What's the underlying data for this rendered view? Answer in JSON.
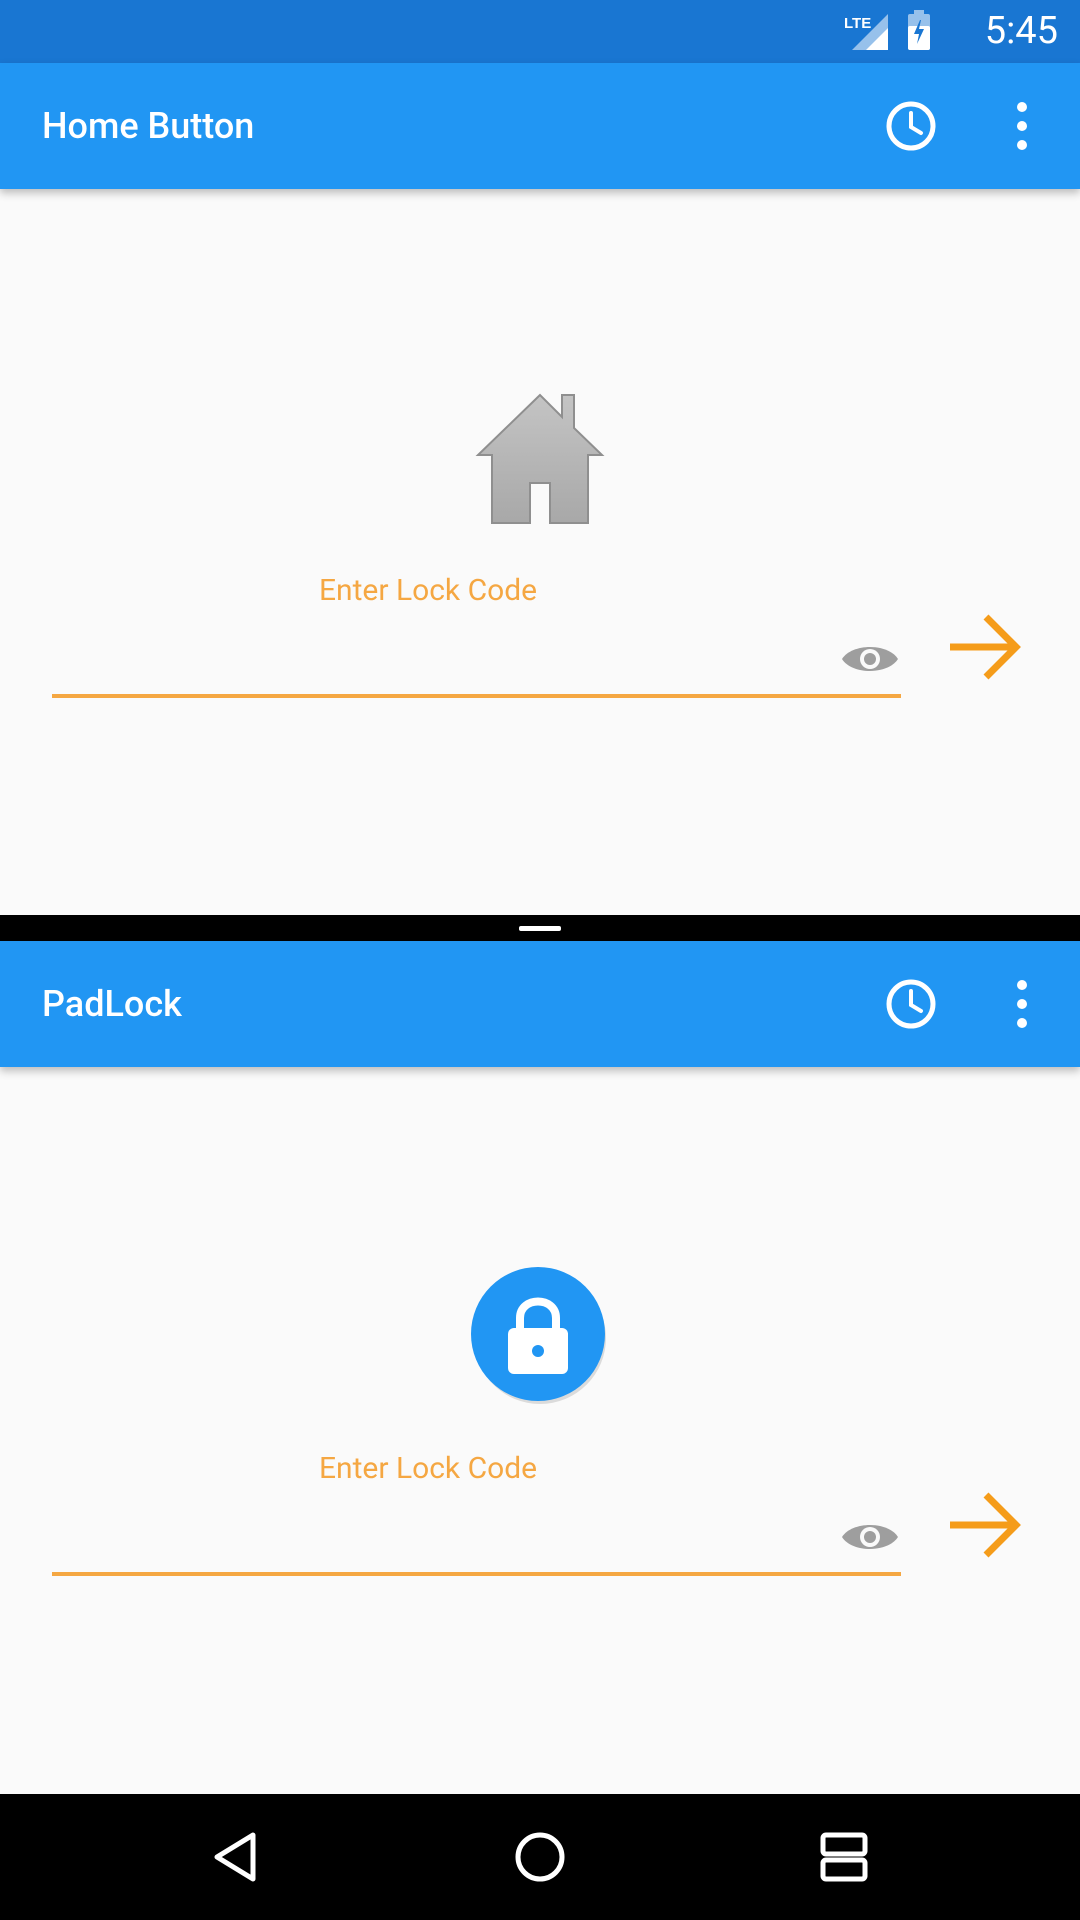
{
  "status_bar": {
    "time": "5:45",
    "network": "LTE",
    "icons": [
      "lte-signal-icon",
      "battery-charging-icon"
    ]
  },
  "top_app": {
    "title": "Home Button",
    "history_icon": "clock-icon",
    "menu_icon": "more-vert-icon",
    "hero_icon": "house-icon",
    "field_label": "Enter Lock Code",
    "input_value": "",
    "visibility_icon": "eye-icon",
    "submit_icon": "arrow-right-icon"
  },
  "bottom_app": {
    "title": "PadLock",
    "history_icon": "clock-icon",
    "menu_icon": "more-vert-icon",
    "hero_icon": "padlock-icon",
    "field_label": "Enter Lock Code",
    "input_value": "",
    "visibility_icon": "eye-icon",
    "submit_icon": "arrow-right-icon"
  },
  "nav_bar": {
    "buttons": [
      "back-icon",
      "home-icon",
      "recents-icon"
    ]
  },
  "colors": {
    "status_bar": "#1976d2",
    "app_bar": "#2196f3",
    "accent": "#f5a742",
    "arrow": "#f59c1a",
    "background": "#fafafa"
  }
}
